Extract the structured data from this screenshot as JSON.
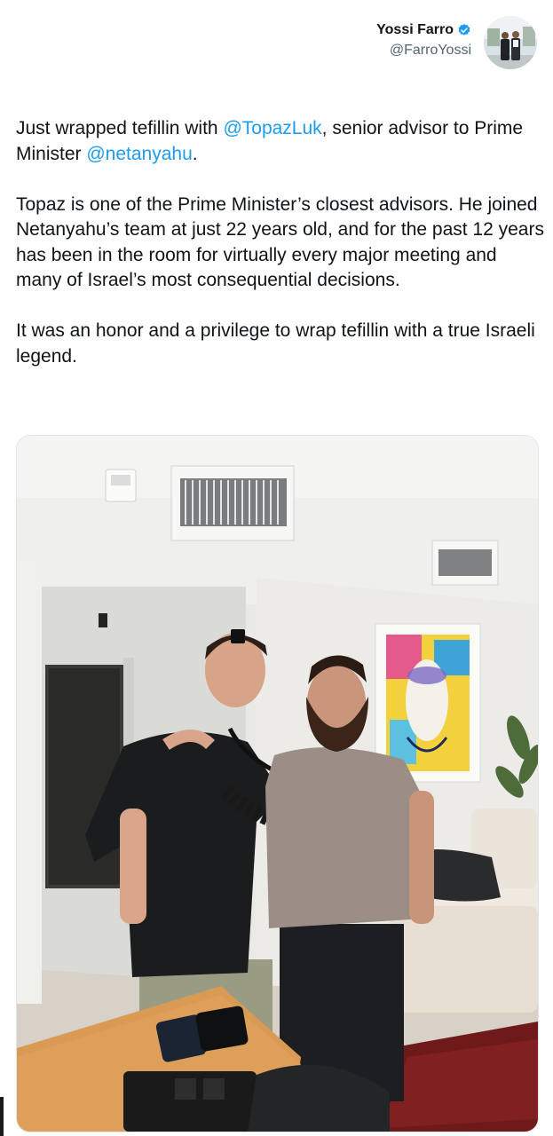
{
  "author": {
    "display_name": "Yossi Farro",
    "handle": "@FarroYossi",
    "verified": true,
    "verified_color": "#1d9bf0"
  },
  "tweet": {
    "p1_before": "Just wrapped tefillin with ",
    "p1_mention1": "@TopazLuk",
    "p1_middle": ", senior advisor to Prime Minister ",
    "p1_mention2": "@netanyahu",
    "p1_after": ".",
    "p2": "Topaz is one of the Prime Minister’s closest advisors. He joined Netanyahu’s team at just 22 years old, and for the past 12 years has been in the room for virtually every major meeting and many of Israel’s most consequential decisions.",
    "p3": "It was an honor and a privilege to wrap tefillin with a true Israeli legend."
  },
  "colors": {
    "mention": "#1d9bf0",
    "text": "#0f1419",
    "secondary": "#536471"
  }
}
